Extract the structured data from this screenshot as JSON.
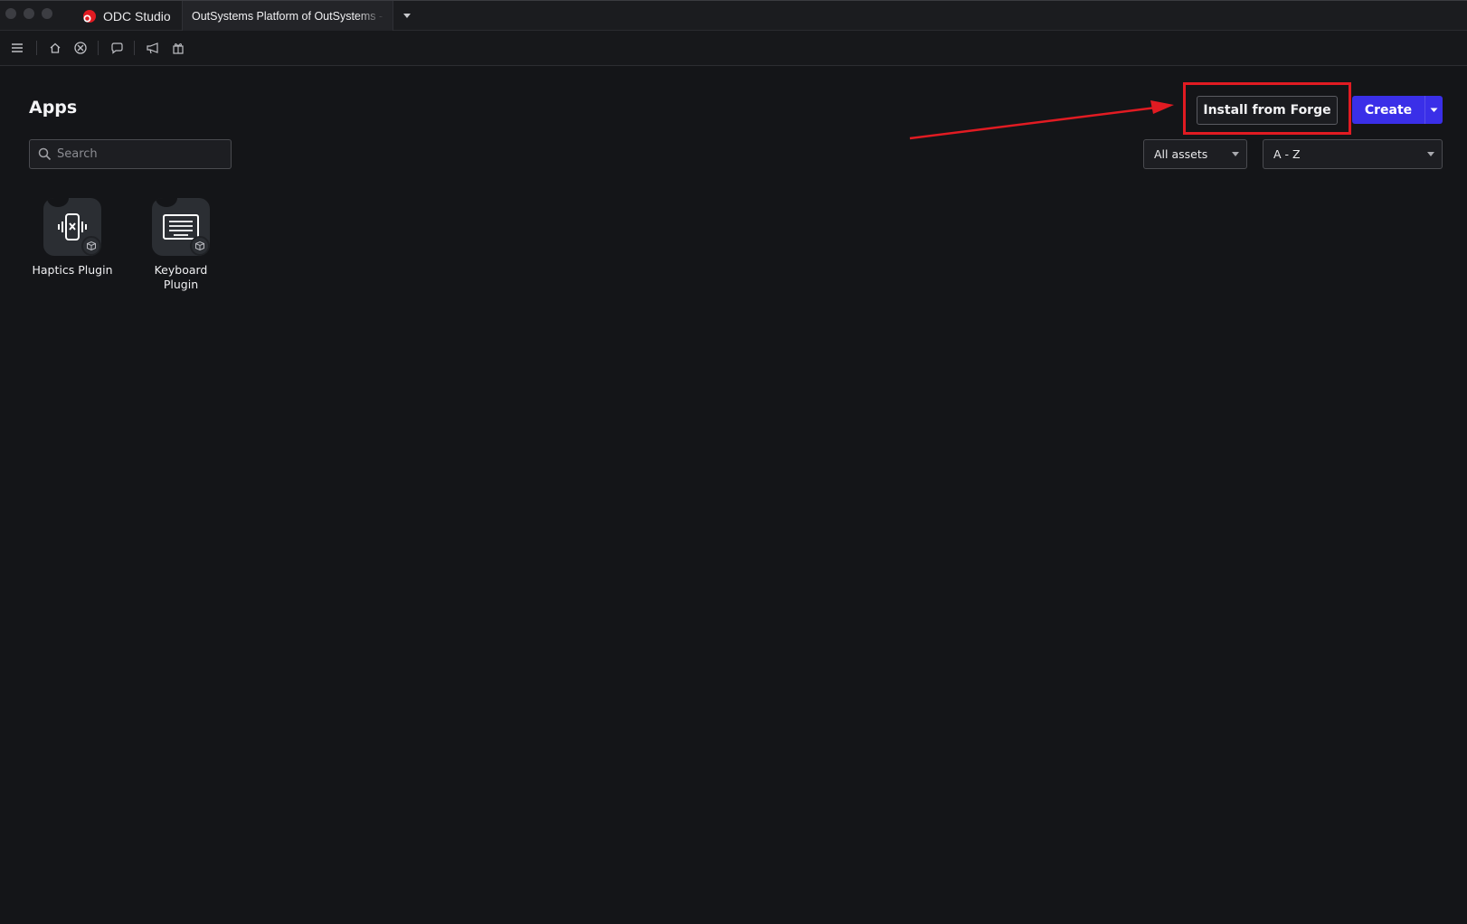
{
  "window": {
    "app_name": "ODC Studio",
    "tab_title": "OutSystems Platform of OutSystems - p"
  },
  "toolbar": {
    "icons": [
      "menu-icon",
      "home-icon",
      "portal-icon",
      "chat-icon",
      "announce-icon",
      "gift-icon"
    ]
  },
  "main": {
    "title": "Apps",
    "search": {
      "placeholder": "Search",
      "value": ""
    },
    "install_button": "Install from Forge",
    "create_button": "Create",
    "filter_select": "All assets",
    "sort_select": "A - Z",
    "apps": [
      {
        "name": "Haptics Plugin",
        "icon": "haptics-icon"
      },
      {
        "name": "Keyboard Plugin",
        "icon": "keyboard-icon"
      }
    ]
  },
  "colors": {
    "background": "#141518",
    "accent": "#3a2fe8",
    "annotation": "#e11b22"
  }
}
